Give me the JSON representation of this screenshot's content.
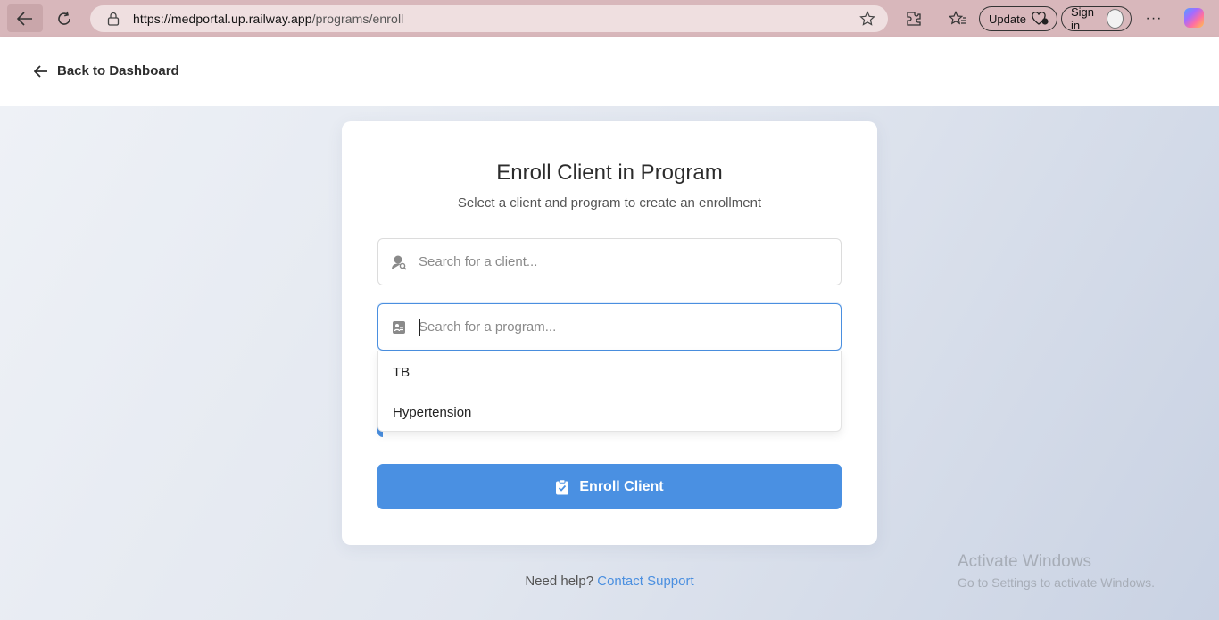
{
  "browser": {
    "url_host": "https://medportal.up.railway.app",
    "url_path": "/programs/enroll",
    "update_label": "Update",
    "signin_label": "Sign in",
    "more_label": "···"
  },
  "header": {
    "back_label": "Back to Dashboard"
  },
  "card": {
    "title": "Enroll Client in Program",
    "subtitle": "Select a client and program to create an enrollment",
    "client_search": {
      "placeholder": "Search for a client...",
      "value": ""
    },
    "program_search": {
      "placeholder": "Search for a program...",
      "value": ""
    },
    "program_options": [
      "TB",
      "Hypertension"
    ],
    "submit_label": "Enroll Client"
  },
  "footer": {
    "help_text": "Need help?",
    "support_link": "Contact Support"
  },
  "watermark": {
    "line1": "Activate Windows",
    "line2": "Go to Settings to activate Windows."
  },
  "colors": {
    "accent": "#4a90e2",
    "browser_bar": "#d8b7bb"
  }
}
